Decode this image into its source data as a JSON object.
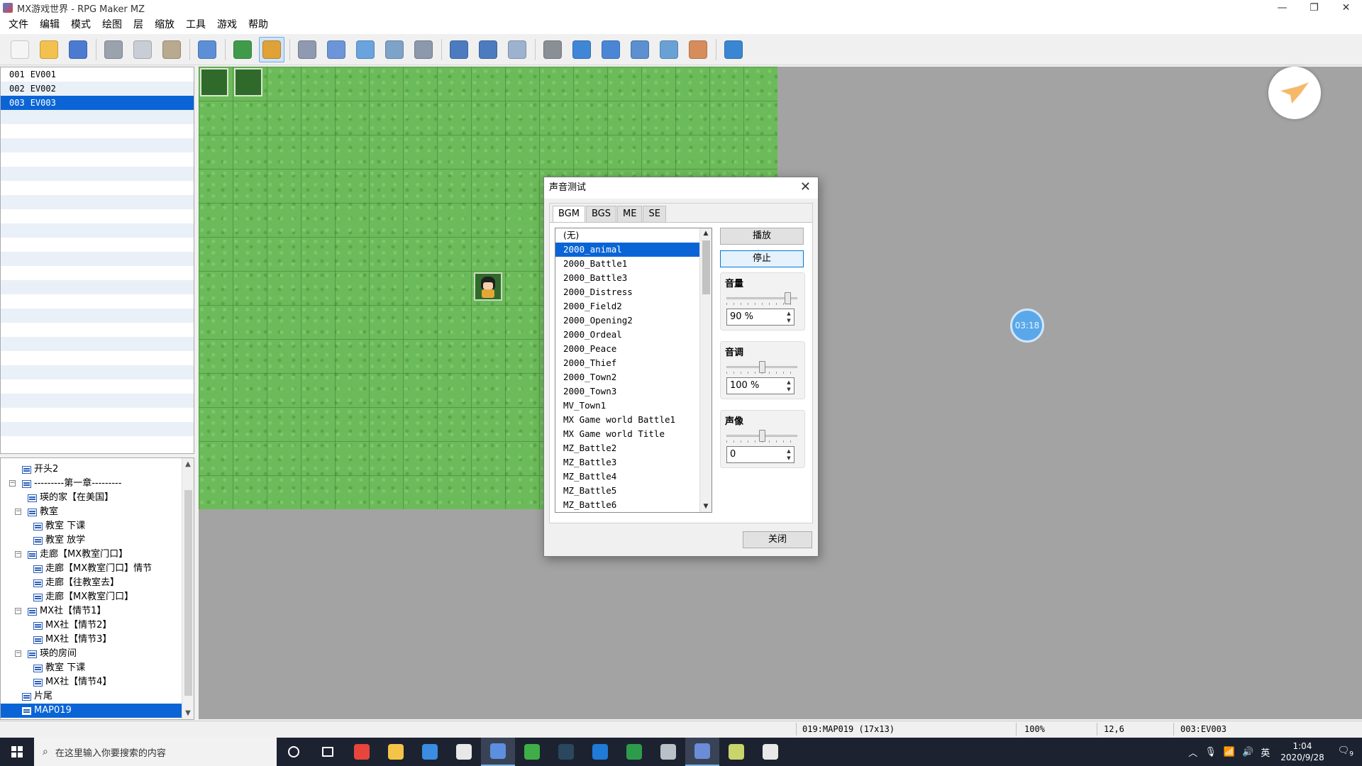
{
  "window": {
    "title": "MX游戏世界 - RPG Maker MZ",
    "controls": [
      "—",
      "❐",
      "✕"
    ]
  },
  "menu": [
    "文件",
    "编辑",
    "模式",
    "绘图",
    "层",
    "缩放",
    "工具",
    "游戏",
    "帮助"
  ],
  "toolbar": {
    "groups": [
      [
        {
          "name": "new-project",
          "color": "#f5f5f5"
        },
        {
          "name": "open-project",
          "color": "#f2c14e"
        },
        {
          "name": "save-project",
          "color": "#4b7bd1"
        }
      ],
      [
        {
          "name": "cut",
          "color": "#9aa3ad"
        },
        {
          "name": "copy",
          "color": "#c9ced6"
        },
        {
          "name": "paste",
          "color": "#b9a98f"
        }
      ],
      [
        {
          "name": "undo",
          "color": "#5d8fd6"
        }
      ],
      [
        {
          "name": "map-mode",
          "color": "#3f9b4a"
        },
        {
          "name": "event-mode",
          "color": "#e0a236",
          "active": true
        }
      ],
      [
        {
          "name": "pencil",
          "color": "#8f9ab0"
        },
        {
          "name": "rectangle",
          "color": "#6b95d8"
        },
        {
          "name": "ellipse",
          "color": "#6aa3de"
        },
        {
          "name": "flood-fill",
          "color": "#7ea3c8"
        },
        {
          "name": "shadow-pen",
          "color": "#8c98ab"
        }
      ],
      [
        {
          "name": "zoom-in",
          "color": "#4c7bbf"
        },
        {
          "name": "zoom-out",
          "color": "#4c7bbf"
        },
        {
          "name": "actual-size",
          "color": "#9db2cf"
        }
      ],
      [
        {
          "name": "database",
          "color": "#8a8f96"
        },
        {
          "name": "plugin-manager",
          "color": "#3f86d6"
        },
        {
          "name": "sound-test",
          "color": "#4b86d6"
        },
        {
          "name": "event-searcher",
          "color": "#5b8fd0"
        },
        {
          "name": "resource-manager",
          "color": "#6aa1d5"
        },
        {
          "name": "character-generator",
          "color": "#d68d5b"
        }
      ],
      [
        {
          "name": "playtest",
          "color": "#3a86d3"
        }
      ]
    ]
  },
  "event_list": {
    "items": [
      {
        "id": "001",
        "name": "EV001"
      },
      {
        "id": "002",
        "name": "EV002"
      },
      {
        "id": "003",
        "name": "EV003",
        "selected": true
      }
    ]
  },
  "map_tree": {
    "items": [
      {
        "label": "开头2",
        "depth": 1,
        "toggle": null
      },
      {
        "label": "---------第一章---------",
        "depth": 1,
        "toggle": "⊟"
      },
      {
        "label": "瑛的家【在美国】",
        "depth": 2,
        "toggle": null
      },
      {
        "label": "教室",
        "depth": 2,
        "toggle": "⊟"
      },
      {
        "label": "教室 下课",
        "depth": 3,
        "toggle": null
      },
      {
        "label": "教室 放学",
        "depth": 3,
        "toggle": null
      },
      {
        "label": "走廊【MX教室门口】",
        "depth": 2,
        "toggle": "⊟"
      },
      {
        "label": "走廊【MX教室门口】情节",
        "depth": 3,
        "toggle": null
      },
      {
        "label": "走廊【往教室去】",
        "depth": 3,
        "toggle": null
      },
      {
        "label": "走廊【MX教室门口】",
        "depth": 3,
        "toggle": null
      },
      {
        "label": "MX社【情节1】",
        "depth": 2,
        "toggle": "⊟"
      },
      {
        "label": "MX社【情节2】",
        "depth": 3,
        "toggle": null
      },
      {
        "label": "MX社【情节3】",
        "depth": 3,
        "toggle": null
      },
      {
        "label": "瑛的房间",
        "depth": 2,
        "toggle": "⊟"
      },
      {
        "label": "教室 下课",
        "depth": 3,
        "toggle": null
      },
      {
        "label": "MX社【情节4】",
        "depth": 3,
        "toggle": null
      },
      {
        "label": "片尾",
        "depth": 1,
        "toggle": null
      },
      {
        "label": "MAP019",
        "depth": 1,
        "toggle": null,
        "selected": true
      }
    ]
  },
  "map": {
    "timer_badge": "03:18"
  },
  "statusbar": {
    "map_info": "019:MAP019 (17x13)",
    "zoom": "100%",
    "coords": "12,6",
    "event": "003:EV003"
  },
  "sound_dialog": {
    "title": "声音测试",
    "close_glyph": "✕",
    "tabs": [
      {
        "label": "BGM",
        "active": true
      },
      {
        "label": "BGS",
        "active": false
      },
      {
        "label": "ME",
        "active": false
      },
      {
        "label": "SE",
        "active": false
      }
    ],
    "files": [
      "(无)",
      "2000_animal",
      "2000_Battle1",
      "2000_Battle3",
      "2000_Distress",
      "2000_Field2",
      "2000_Opening2",
      "2000_Ordeal",
      "2000_Peace",
      "2000_Thief",
      "2000_Town2",
      "2000_Town3",
      "MV_Town1",
      "MX Game world Battle1",
      "MX Game world Title",
      "MZ_Battle2",
      "MZ_Battle3",
      "MZ_Battle4",
      "MZ_Battle5",
      "MZ_Battle6"
    ],
    "selected_file": "2000_animal",
    "play_label": "播放",
    "stop_label": "停止",
    "close_label": "关闭",
    "volume": {
      "label": "音量",
      "value": "90 %",
      "level": 0.9
    },
    "pitch": {
      "label": "音调",
      "value": "100 %",
      "level": 0.5
    },
    "pan": {
      "label": "声像",
      "value": "0",
      "level": 0.5
    }
  },
  "taskbar": {
    "search_placeholder": "在这里输入你要搜索的内容",
    "apps": [
      {
        "name": "cortana",
        "color": "transparent"
      },
      {
        "name": "task-view",
        "color": "transparent"
      },
      {
        "name": "chrome",
        "color": "#e8453c"
      },
      {
        "name": "file-explorer",
        "color": "#f3c447"
      },
      {
        "name": "store",
        "color": "#3a8de0"
      },
      {
        "name": "mail",
        "color": "#e8e8e8"
      },
      {
        "name": "app-bird",
        "color": "#5d8fe0",
        "active": true
      },
      {
        "name": "app-green",
        "color": "#3fae49"
      },
      {
        "name": "steam",
        "color": "#2a475e"
      },
      {
        "name": "app-blue",
        "color": "#1f7ad8"
      },
      {
        "name": "app-game",
        "color": "#2d9c4a"
      },
      {
        "name": "app-chat",
        "color": "#b8c0c8"
      },
      {
        "name": "rpg-maker",
        "color": "#6b8cd6",
        "active": true
      },
      {
        "name": "app-dragon",
        "color": "#c9d46a"
      },
      {
        "name": "app-cat",
        "color": "#e8e8e8"
      }
    ],
    "ime": "英",
    "time": "1:04",
    "date": "2020/9/28",
    "notifications": "9"
  }
}
